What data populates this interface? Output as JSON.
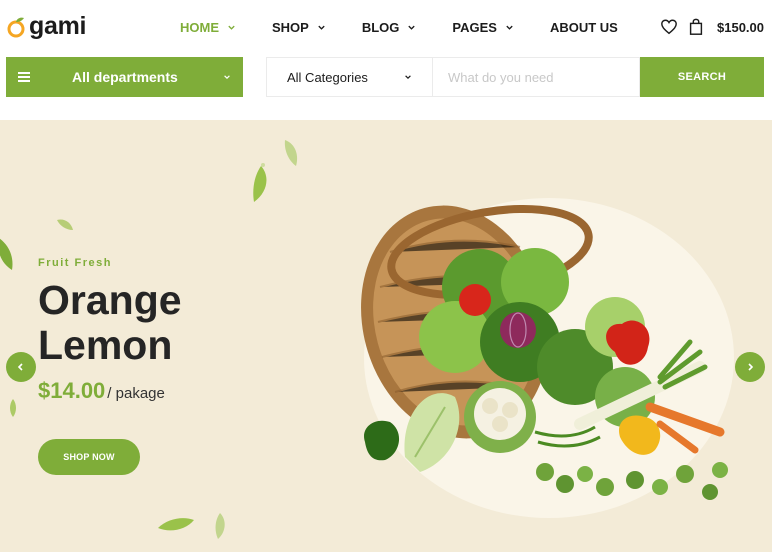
{
  "logo": {
    "first_letter": "O",
    "rest": "gami"
  },
  "nav": {
    "items": [
      {
        "label": "HOME",
        "active": true,
        "has_dropdown": true
      },
      {
        "label": "SHOP",
        "active": false,
        "has_dropdown": true
      },
      {
        "label": "BLOG",
        "active": false,
        "has_dropdown": true
      },
      {
        "label": "PAGES",
        "active": false,
        "has_dropdown": true
      },
      {
        "label": "ABOUT US",
        "active": false,
        "has_dropdown": false
      }
    ]
  },
  "header_right": {
    "wishlist_icon": "heart-icon",
    "cart_icon": "shopping-bag-icon",
    "cart_total": "$150.00"
  },
  "departments": {
    "label": "All departments",
    "icon": "menu-icon"
  },
  "search": {
    "category": "All Categories",
    "placeholder": "What do you need",
    "button_label": "SEARCH"
  },
  "hero": {
    "tag": "Fruit Fresh",
    "title_line1": "Orange",
    "title_line2": "Lemon",
    "price": "$14.00",
    "unit": "/ pakage",
    "button_label": "SHOP NOW",
    "prev_icon": "chevron-left-icon",
    "next_icon": "chevron-right-icon"
  },
  "colors": {
    "accent": "#7fad39",
    "hero_bg": "#f3ebd7",
    "text": "#1c1c1c",
    "logo_accent": "#f5a623"
  }
}
